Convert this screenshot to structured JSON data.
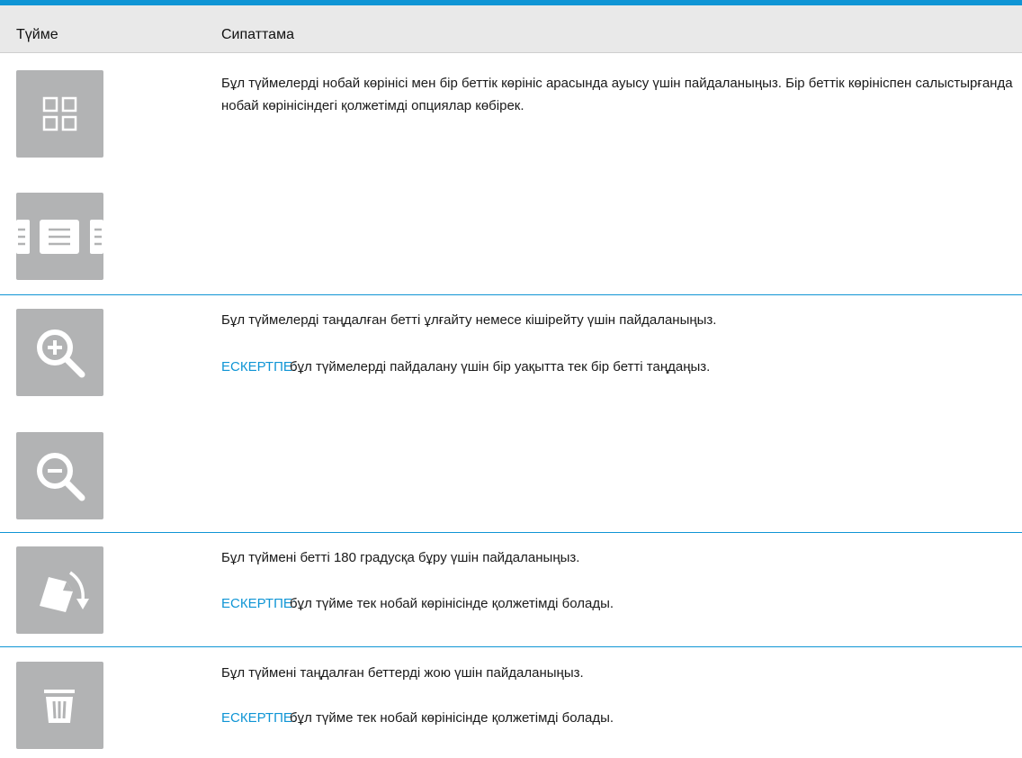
{
  "table": {
    "header": {
      "col_button": "Түйме",
      "col_description": "Сипаттама"
    },
    "note_label": "ЕСКЕРТПЕ:",
    "rows": [
      {
        "icons": [
          "grid-view-icon",
          "single-page-view-icon"
        ],
        "description": "Бұл түймелерді нобай көрінісі мен бір беттік көрініс арасында ауысу үшін пайдаланыңыз. Бір беттік көрініспен салыстырғанда нобай көрінісіндегі қолжетімді опциялар көбірек."
      },
      {
        "icons": [
          "zoom-in-icon",
          "zoom-out-icon"
        ],
        "description": "Бұл түймелерді таңдалған бетті ұлғайту немесе кішірейту үшін пайдаланыңыз.",
        "note": "бұл түймелерді пайдалану үшін бір уақытта тек бір бетті таңдаңыз."
      },
      {
        "icons": [
          "rotate-page-icon"
        ],
        "description": "Бұл түймені бетті 180 градусқа бұру үшін пайдаланыңыз.",
        "note": "бұл түйме тек нобай көрінісінде қолжетімді болады."
      },
      {
        "icons": [
          "trash-icon"
        ],
        "description": "Бұл түймені таңдалған беттерді жою үшін пайдаланыңыз.",
        "note": "бұл түйме тек нобай көрінісінде қолжетімді болады."
      }
    ]
  },
  "colors": {
    "accent": "#0f95d5",
    "button_bg": "#b2b3b4",
    "header_bg": "#e9e9e9"
  }
}
